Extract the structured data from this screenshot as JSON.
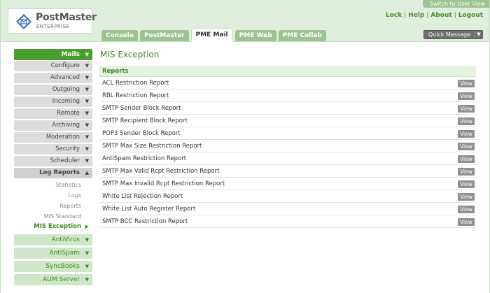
{
  "header": {
    "logo_text": "PostMaster",
    "logo_sub": "ENTERPRISE",
    "switch_link": "Switch to User View",
    "links": [
      "Lock",
      "Help",
      "About",
      "Logout"
    ],
    "tabs": [
      "Console",
      "PostMaster",
      "PME Mail",
      "PME Web",
      "PME Collab"
    ],
    "active_tab": "PME Mail",
    "quick_message": "Quick Message"
  },
  "sidebar": {
    "main": "Mails",
    "items": [
      "Configure",
      "Advanced",
      "Outgoing",
      "Incoming",
      "Remote",
      "Archiving",
      "Moderation",
      "Security",
      "Scheduler"
    ],
    "open_item": "Log Reports",
    "sub_items": [
      "Statistics",
      "Logs",
      "Reports",
      "MIS Standard"
    ],
    "current_item": "MIS Exception",
    "green_items": [
      "AntiVirus",
      "AntiSpam",
      "SyncBooks",
      "AUM Server"
    ]
  },
  "main": {
    "title": "MIS Exception",
    "section": "Reports",
    "view_label": "View",
    "reports": [
      "ACL Restriction Report",
      "RBL Restriction Report",
      "SMTP Sender Block Report",
      "SMTP Recipient Block Report",
      "POP3 Sender Block Report",
      "SMTP Max Size Restriction Report",
      "AntiSpam Restriction Report",
      "SMTP Max Valid Rcpt Restriction Report",
      "SMTP Max Invalid Rcpt Restriction Report",
      "White List Rejection Report",
      "White List Auto Register Report",
      "SMTP BCC Restriction Report"
    ]
  },
  "icons": {
    "logo": "envelope-shield-icon",
    "caret_down": "caret-down-icon",
    "caret_up": "caret-up-icon",
    "caret_right": "caret-right-icon"
  },
  "colors": {
    "brand_green": "#47a02e",
    "header_bg": "#dfeedd",
    "tab_green": "#9cc48e",
    "text_green": "#3d8a23"
  }
}
